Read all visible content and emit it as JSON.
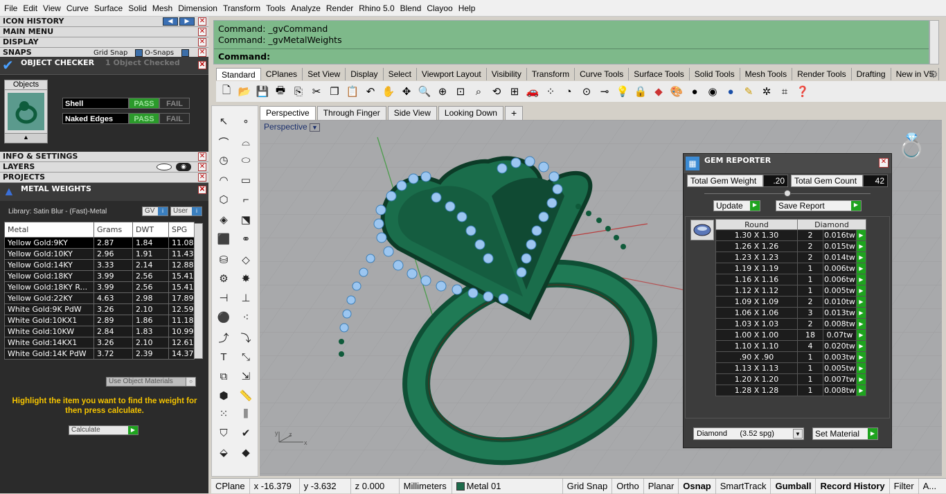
{
  "menu": [
    "File",
    "Edit",
    "View",
    "Curve",
    "Surface",
    "Solid",
    "Mesh",
    "Dimension",
    "Transform",
    "Tools",
    "Analyze",
    "Render",
    "Rhino 5.0",
    "Blend",
    "Clayoo",
    "Help"
  ],
  "left_panel": {
    "headers": {
      "icon_history": "ICON HISTORY",
      "main_menu": "MAIN MENU",
      "display": "DISPLAY",
      "snaps": "SNAPS",
      "info": "INFO & SETTINGS",
      "layers": "LAYERS",
      "projects": "PROJECTS"
    },
    "snaps": {
      "grid_snap": "Grid Snap",
      "osnaps": "O-Snaps"
    },
    "object_checker": {
      "title": "OBJECT CHECKER",
      "status": "1  Object Checked",
      "objects_label": "Objects",
      "checks": [
        {
          "name": "Shell",
          "pass": "PASS",
          "fail": "FAIL"
        },
        {
          "name": "Naked Edges",
          "pass": "PASS",
          "fail": "FAIL"
        }
      ]
    },
    "metal_weights": {
      "title": "METAL WEIGHTS",
      "library": "Library: Satin Blur - (Fast)-Metal",
      "gv": "GV",
      "user": "User",
      "columns": [
        "Metal",
        "Grams",
        "DWT",
        "SPG"
      ],
      "rows": [
        [
          "Yellow Gold:9KY",
          "2.87",
          "1.84",
          "11.08"
        ],
        [
          "Yellow Gold:10KY",
          "2.96",
          "1.91",
          "11.43"
        ],
        [
          "Yellow Gold:14KY",
          "3.33",
          "2.14",
          "12.88"
        ],
        [
          "Yellow Gold:18KY",
          "3.99",
          "2.56",
          "15.41"
        ],
        [
          "Yellow Gold:18KY R...",
          "3.99",
          "2.56",
          "15.41"
        ],
        [
          "Yellow Gold:22KY",
          "4.63",
          "2.98",
          "17.89"
        ],
        [
          "White Gold:9K PdW",
          "3.26",
          "2.10",
          "12.59"
        ],
        [
          "White Gold:10KX1",
          "2.89",
          "1.86",
          "11.18"
        ],
        [
          "White Gold:10KW",
          "2.84",
          "1.83",
          "10.99"
        ],
        [
          "White Gold:14KX1",
          "3.26",
          "2.10",
          "12.61"
        ],
        [
          "White Gold:14K PdW",
          "3.72",
          "2.39",
          "14.37"
        ]
      ],
      "use_object_materials": "Use Object Materials",
      "hint": "Highlight the item you want to find the weight for then press calculate.",
      "calculate": "Calculate"
    }
  },
  "command": {
    "history": [
      "Command: _gvCommand",
      "Command: _gvMetalWeights"
    ],
    "prompt": "Command:"
  },
  "toolbar_tabs": [
    "Standard",
    "CPlanes",
    "Set View",
    "Display",
    "Select",
    "Viewport Layout",
    "Visibility",
    "Transform",
    "Curve Tools",
    "Surface Tools",
    "Solid Tools",
    "Mesh Tools",
    "Render Tools",
    "Drafting",
    "New in V5"
  ],
  "viewport_tabs": [
    "Perspective",
    "Through Finger",
    "Side View",
    "Looking Down"
  ],
  "viewport_label": "Perspective",
  "gem_reporter": {
    "title": "GEM REPORTER",
    "total_weight_label": "Total Gem Weight",
    "total_weight": ".20",
    "total_count_label": "Total Gem Count",
    "total_count": "42",
    "update": "Update",
    "save_report": "Save Report",
    "columns": [
      "Round",
      "Diamond"
    ],
    "rows": [
      [
        "1.30 X 1.30",
        "2",
        "0.016tw"
      ],
      [
        "1.26 X 1.26",
        "2",
        "0.015tw"
      ],
      [
        "1.23 X 1.23",
        "2",
        "0.014tw"
      ],
      [
        "1.19 X 1.19",
        "1",
        "0.006tw"
      ],
      [
        "1.16 X 1.16",
        "1",
        "0.006tw"
      ],
      [
        "1.12 X 1.12",
        "1",
        "0.005tw"
      ],
      [
        "1.09 X 1.09",
        "2",
        "0.010tw"
      ],
      [
        "1.06 X 1.06",
        "3",
        "0.013tw"
      ],
      [
        "1.03 X 1.03",
        "2",
        "0.008tw"
      ],
      [
        "1.00 X 1.00",
        "18",
        "0.07tw"
      ],
      [
        "1.10 X 1.10",
        "4",
        "0.020tw"
      ],
      [
        ".90 X .90",
        "1",
        "0.003tw"
      ],
      [
        "1.13 X 1.13",
        "1",
        "0.005tw"
      ],
      [
        "1.20 X 1.20",
        "1",
        "0.007tw"
      ],
      [
        "1.28 X 1.28",
        "1",
        "0.008tw"
      ]
    ],
    "material": "Diamond      (3.52 spg)",
    "set_material": "Set Material"
  },
  "status": {
    "cplane": "CPlane",
    "x": "x -16.379",
    "y": "y -3.632",
    "z": "z 0.000",
    "units": "Millimeters",
    "layer": "Metal 01",
    "toggles": [
      "Grid Snap",
      "Ortho",
      "Planar",
      "Osnap",
      "SmartTrack",
      "Gumball",
      "Record History",
      "Filter",
      "A..."
    ]
  },
  "colors": {
    "metal_green": "#1d6b4b",
    "gem_blue": "#9cc6f0",
    "command_bg": "#7eb98a",
    "pass_green": "#1ea31e",
    "hint_yellow": "#f5c400"
  }
}
